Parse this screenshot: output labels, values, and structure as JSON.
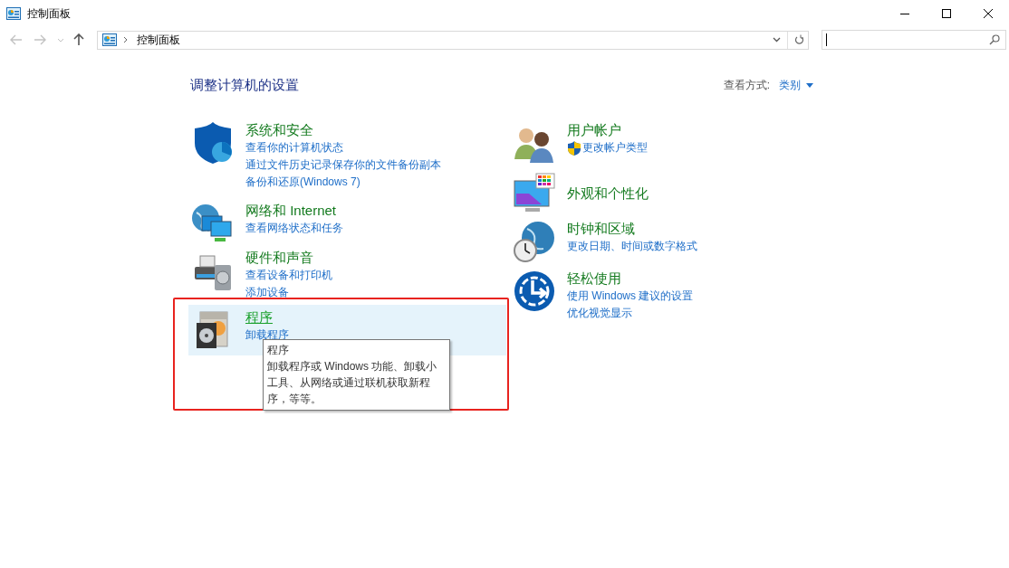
{
  "window": {
    "title": "控制面板"
  },
  "address_bar": {
    "path": "控制面板"
  },
  "heading": "调整计算机的设置",
  "view_by": {
    "label": "查看方式:",
    "value": "类别"
  },
  "left_column": [
    {
      "title": "系统和安全",
      "selected": false,
      "links": [
        {
          "text": "查看你的计算机状态",
          "shield": false
        },
        {
          "text": "通过文件历史记录保存你的文件备份副本",
          "shield": false
        },
        {
          "text": "备份和还原(Windows 7)",
          "shield": false
        }
      ]
    },
    {
      "title": "网络和 Internet",
      "selected": false,
      "links": [
        {
          "text": "查看网络状态和任务",
          "shield": false
        }
      ]
    },
    {
      "title": "硬件和声音",
      "selected": false,
      "links": [
        {
          "text": "查看设备和打印机",
          "shield": false
        },
        {
          "text": "添加设备",
          "shield": false
        }
      ]
    },
    {
      "title": "程序",
      "selected": true,
      "links": [
        {
          "text": "卸载程序",
          "shield": false
        }
      ]
    }
  ],
  "right_column": [
    {
      "title": "用户帐户",
      "selected": false,
      "links": [
        {
          "text": "更改帐户类型",
          "shield": true
        }
      ]
    },
    {
      "title": "外观和个性化",
      "selected": false
    },
    {
      "title": "时钟和区域",
      "selected": false,
      "links": [
        {
          "text": "更改日期、时间或数字格式",
          "shield": false
        }
      ]
    },
    {
      "title": "轻松使用",
      "selected": false,
      "links": [
        {
          "text": "使用 Windows 建议的设置",
          "shield": false
        },
        {
          "text": "优化视觉显示",
          "shield": false
        }
      ]
    }
  ],
  "tooltip": {
    "title": "程序",
    "body": "卸载程序或 Windows 功能、卸载小工具、从网络或通过联机获取新程序，等等。"
  }
}
